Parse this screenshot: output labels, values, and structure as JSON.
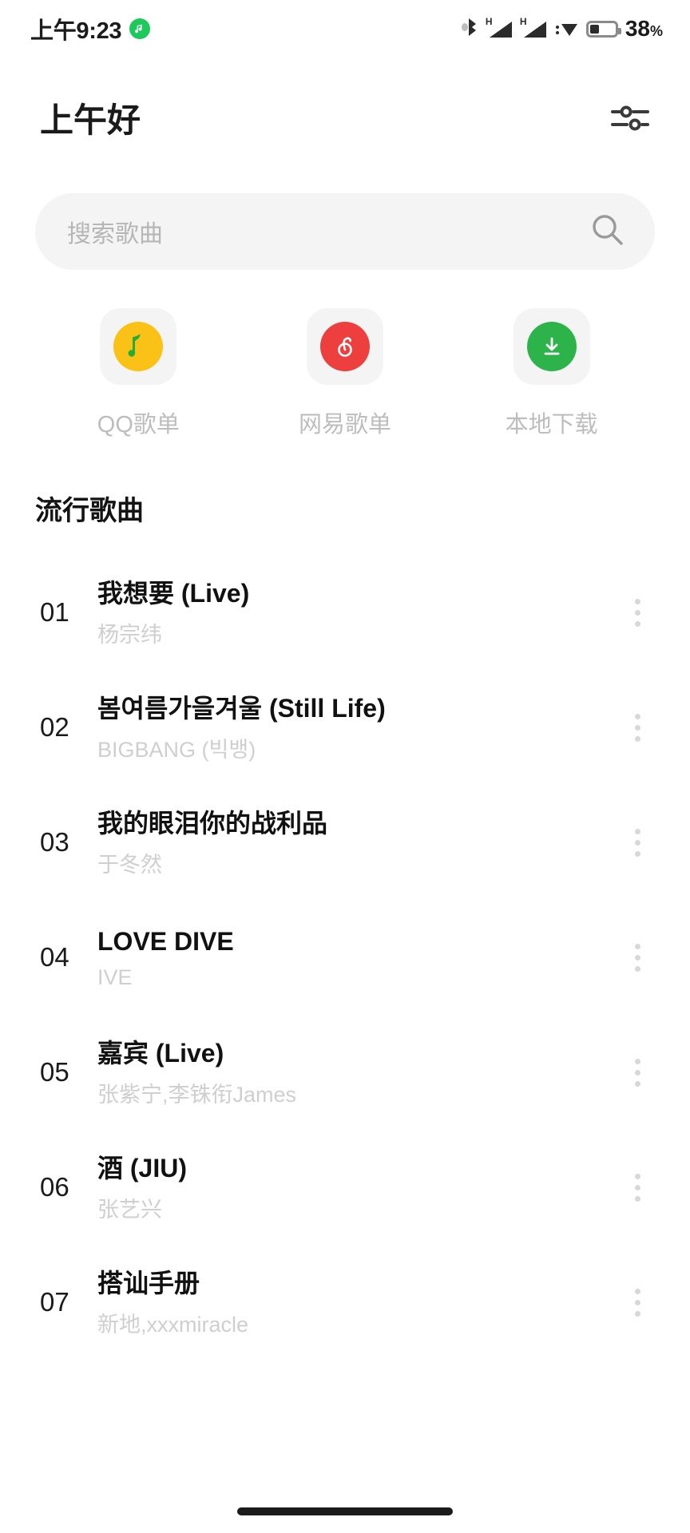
{
  "status_bar": {
    "time": "上午9:23",
    "app_indicator_icon": "music-app-dot-icon",
    "icons": [
      "bluetooth-icon",
      "signal-h-icon",
      "signal-h-icon",
      "wifi-icon",
      "battery-icon"
    ],
    "signal_label": "H",
    "battery_percent": "38",
    "battery_percent_symbol": "%",
    "battery_level": 38
  },
  "header": {
    "greeting": "上午好",
    "settings_icon": "tune-sliders-icon"
  },
  "search": {
    "placeholder": "搜索歌曲",
    "value": "",
    "icon": "search-icon"
  },
  "shortcuts": [
    {
      "label": "QQ歌单",
      "icon": "qq-music-note-icon",
      "bg": "#FAC216",
      "fg": "#22AC38"
    },
    {
      "label": "网易歌单",
      "icon": "netease-cloud-music-icon",
      "bg": "#EE3F3F",
      "fg": "#FFFFFF"
    },
    {
      "label": "本地下载",
      "icon": "download-icon",
      "bg": "#2CB34A",
      "fg": "#FFFFFF"
    }
  ],
  "section": {
    "title": "流行歌曲"
  },
  "songs": [
    {
      "num": "01",
      "title": "我想要 (Live)",
      "artist": "杨宗纬"
    },
    {
      "num": "02",
      "title": "봄여름가을겨울 (Still Life)",
      "artist": "BIGBANG (빅뱅)"
    },
    {
      "num": "03",
      "title": "我的眼泪你的战利品",
      "artist": "于冬然"
    },
    {
      "num": "04",
      "title": "LOVE DIVE",
      "artist": "IVE"
    },
    {
      "num": "05",
      "title": "嘉宾 (Live)",
      "artist": "张紫宁,李铢衔James"
    },
    {
      "num": "06",
      "title": "酒 (JIU)",
      "artist": "张艺兴"
    },
    {
      "num": "07",
      "title": "搭讪手册",
      "artist": "新地,xxxmiracle"
    }
  ],
  "colors": {
    "accent_green": "#2CB34A",
    "greeting_highlight": "#E9F6EC",
    "field_bg": "#F4F4F4",
    "muted_text": "#CFCFCF"
  }
}
